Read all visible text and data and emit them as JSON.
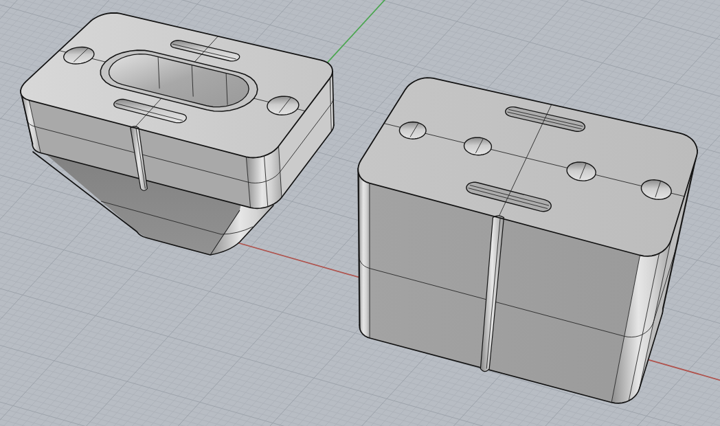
{
  "viewport": {
    "axes": [
      {
        "kind": "x",
        "color": "#b0524c"
      },
      {
        "kind": "y",
        "color": "#4aa64f"
      }
    ],
    "objects": [
      {
        "kind": "funnel"
      },
      {
        "kind": "box"
      }
    ]
  }
}
